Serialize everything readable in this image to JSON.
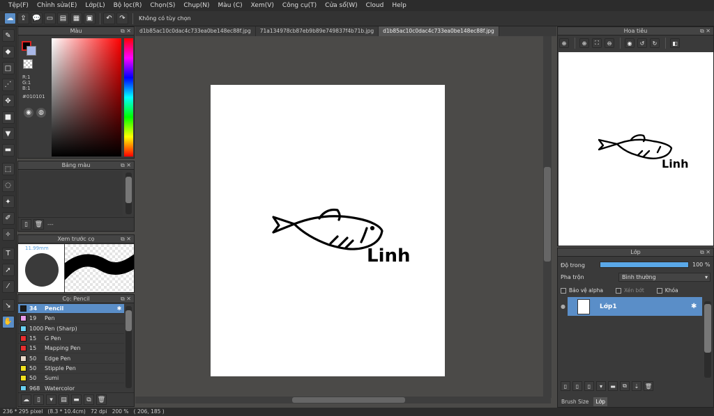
{
  "menu": [
    "Tệp(F)",
    "Chỉnh sửa(E)",
    "Lớp(L)",
    "Bộ lọc(R)",
    "Chọn(S)",
    "Chụp(N)",
    "Màu (C)",
    "Xem(V)",
    "Công cụ(T)",
    "Cửa sổ(W)",
    "Cloud",
    "Help"
  ],
  "toolbar": {
    "hint": "Không có tùy chọn"
  },
  "color_panel": {
    "title": "Màu",
    "rgb": "R:1\nG:1\nB:1",
    "hex": "#010101",
    "fg": "#010101",
    "bg": "#a9b8e8"
  },
  "swatch_panel": {
    "title": "Bảng màu",
    "foot": "---"
  },
  "preview_panel": {
    "title": "Xem trước cọ",
    "size": "11.99mm"
  },
  "brush_panel": {
    "title": "Cọ: Pencil",
    "brushes": [
      {
        "size": "34",
        "name": "Pencil",
        "color": "#1a1a1a"
      },
      {
        "size": "19",
        "name": "Pen",
        "color": "#e89ae8"
      },
      {
        "size": "1000",
        "name": "Pen (Sharp)",
        "color": "#6ad0f0"
      },
      {
        "size": "15",
        "name": "G Pen",
        "color": "#e83030"
      },
      {
        "size": "15",
        "name": "Mapping Pen",
        "color": "#e83030"
      },
      {
        "size": "50",
        "name": "Edge Pen",
        "color": "#e8d8c8"
      },
      {
        "size": "50",
        "name": "Stipple Pen",
        "color": "#f0e020"
      },
      {
        "size": "50",
        "name": "Sumi",
        "color": "#f0e020"
      },
      {
        "size": "968",
        "name": "Watercolor",
        "color": "#6ad0f0"
      }
    ]
  },
  "tabs": [
    "d1b85ac10c0dac4c733ea0be148ec88f.jpg",
    "71a134978cb87eb9b89e749837f4b71b.jpg",
    "d1b85ac10c0dac4c733ea0be148ec88f.jpg"
  ],
  "canvas": {
    "drawing_text": "Linh"
  },
  "navigator": {
    "title": "Hoa tiêu"
  },
  "layer_panel": {
    "title": "Lớp",
    "opacity_label": "Độ trong",
    "opacity_value": "100 %",
    "opacity": 1.0,
    "blend_label": "Pha trộn",
    "blend_value": "Bình thường",
    "protect_alpha": "Bảo vệ alpha",
    "clipping": "Xén bớt",
    "lock": "Khóa",
    "layer_name": "Lớp1"
  },
  "bottom_tabs": [
    "Brush Size",
    "Lớp"
  ],
  "status": "236 * 295 pixel   (8.3 * 10.4cm)   72 dpi   200 %   ( 206, 185 )"
}
